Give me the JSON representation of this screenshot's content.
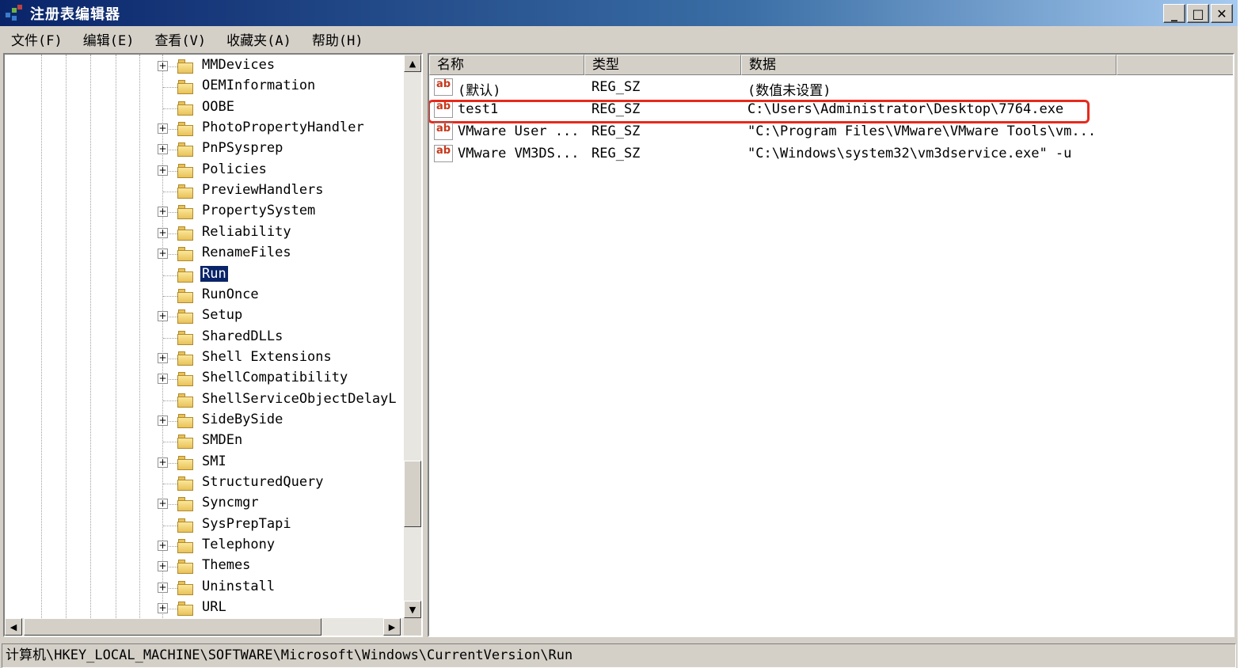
{
  "window": {
    "title": "注册表编辑器",
    "minimize": "_",
    "maximize": "□",
    "close": "✕"
  },
  "menu": [
    "文件(F)",
    "编辑(E)",
    "查看(V)",
    "收藏夹(A)",
    "帮助(H)"
  ],
  "tree": {
    "items": [
      {
        "label": "MMDevices",
        "expandable": true
      },
      {
        "label": "OEMInformation",
        "expandable": false
      },
      {
        "label": "OOBE",
        "expandable": false
      },
      {
        "label": "PhotoPropertyHandler",
        "expandable": true
      },
      {
        "label": "PnPSysprep",
        "expandable": true
      },
      {
        "label": "Policies",
        "expandable": true
      },
      {
        "label": "PreviewHandlers",
        "expandable": false
      },
      {
        "label": "PropertySystem",
        "expandable": true
      },
      {
        "label": "Reliability",
        "expandable": true
      },
      {
        "label": "RenameFiles",
        "expandable": true
      },
      {
        "label": "Run",
        "expandable": false,
        "selected": true
      },
      {
        "label": "RunOnce",
        "expandable": false
      },
      {
        "label": "Setup",
        "expandable": true
      },
      {
        "label": "SharedDLLs",
        "expandable": false
      },
      {
        "label": "Shell Extensions",
        "expandable": true
      },
      {
        "label": "ShellCompatibility",
        "expandable": true
      },
      {
        "label": "ShellServiceObjectDelayL",
        "expandable": false
      },
      {
        "label": "SideBySide",
        "expandable": true
      },
      {
        "label": "SMDEn",
        "expandable": false
      },
      {
        "label": "SMI",
        "expandable": true
      },
      {
        "label": "StructuredQuery",
        "expandable": false
      },
      {
        "label": "Syncmgr",
        "expandable": true
      },
      {
        "label": "SysPrepTapi",
        "expandable": false
      },
      {
        "label": "Telephony",
        "expandable": true
      },
      {
        "label": "Themes",
        "expandable": true
      },
      {
        "label": "Uninstall",
        "expandable": true
      },
      {
        "label": "URL",
        "expandable": true
      }
    ]
  },
  "list": {
    "columns": [
      "名称",
      "类型",
      "数据"
    ],
    "rows": [
      {
        "name": "(默认)",
        "type": "REG_SZ",
        "data": "(数值未设置)",
        "highlighted": false
      },
      {
        "name": "test1",
        "type": "REG_SZ",
        "data": "C:\\Users\\Administrator\\Desktop\\7764.exe",
        "highlighted": true
      },
      {
        "name": "VMware User ...",
        "type": "REG_SZ",
        "data": "\"C:\\Program Files\\VMware\\VMware Tools\\vm...",
        "highlighted": false
      },
      {
        "name": "VMware VM3DS...",
        "type": "REG_SZ",
        "data": "\"C:\\Windows\\system32\\vm3dservice.exe\" -u",
        "highlighted": false
      }
    ],
    "icon_text": "ab"
  },
  "status": {
    "path": "计算机\\HKEY_LOCAL_MACHINE\\SOFTWARE\\Microsoft\\Windows\\CurrentVersion\\Run"
  },
  "colors": {
    "title_bar": "#0a246a",
    "selection": "#0a246a",
    "highlight_box": "#e62a1c",
    "folder": "#f5d57a"
  }
}
